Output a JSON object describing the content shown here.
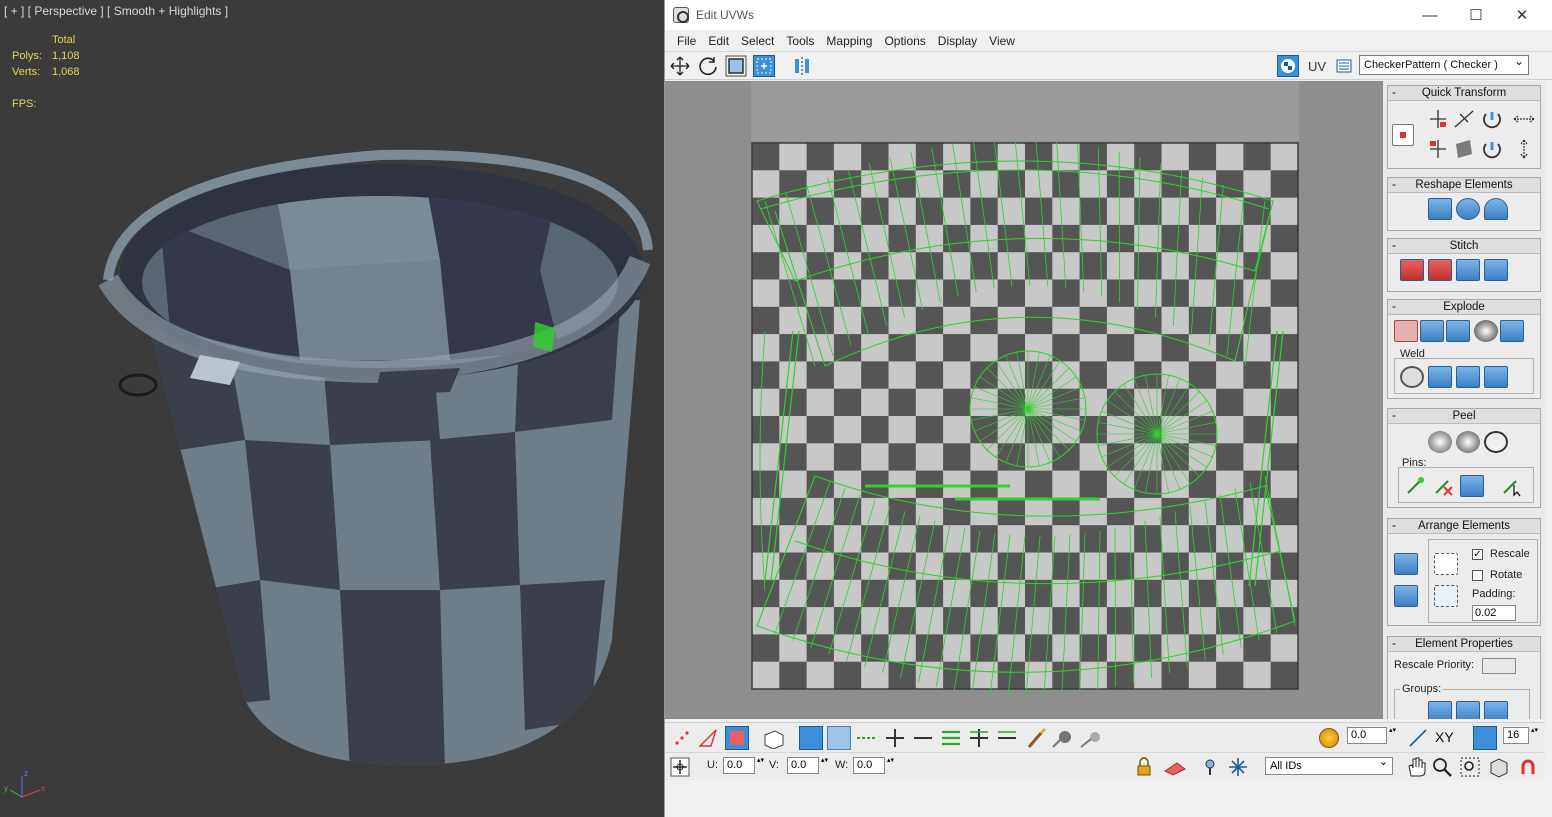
{
  "viewport": {
    "label": "[ + ] [ Perspective ] [ Smooth + Highlights ]",
    "stats": {
      "total_label": "Total",
      "polys_label": "Polys:",
      "polys_value": "1,108",
      "verts_label": "Verts:",
      "verts_value": "1,068",
      "fps_label": "FPS:"
    },
    "axis_labels": {
      "x": "x",
      "y": "y",
      "z": "z"
    }
  },
  "window": {
    "title": "Edit UVWs",
    "controls": {
      "minimize": "—",
      "maximize": "☐",
      "close": "✕"
    }
  },
  "menu": [
    "File",
    "Edit",
    "Select",
    "Tools",
    "Mapping",
    "Options",
    "Display",
    "View"
  ],
  "toolbar": {
    "uv_label": "UV",
    "texture_dropdown": "CheckerPattern  ( Checker )"
  },
  "panel": {
    "quick_transform": "Quick Transform",
    "reshape_elements": "Reshape Elements",
    "stitch": "Stitch",
    "explode": "Explode",
    "weld": "Weld",
    "peel": "Peel",
    "pins": "Pins:",
    "arrange_elements": "Arrange Elements",
    "rescale": "Rescale",
    "rotate": "Rotate",
    "padding_label": "Padding:",
    "padding_value": "0.02",
    "element_properties": "Element Properties",
    "rescale_priority": "Rescale Priority:",
    "groups": "Groups:"
  },
  "bottom": {
    "soft_value": "0.0",
    "xy_label": "XY",
    "grid_value": "16",
    "u_label": "U:",
    "u_value": "0.0",
    "v_label": "V:",
    "v_value": "0.0",
    "w_label": "W:",
    "w_value": "0.0",
    "ids_dropdown": "All IDs"
  },
  "colors": {
    "uv_wire": "#2fd12f",
    "checker_dark": "#555555",
    "checker_light": "#c8c8c8",
    "accent_blue": "#3c8fd8",
    "viewport_bg": "#3b3b3b",
    "stats_yellow": "#e6d35c"
  },
  "icons": [
    "move-icon",
    "rotate-icon",
    "scale-icon",
    "freeform-icon",
    "mirror-icon",
    "checker-icon",
    "options-icon"
  ]
}
